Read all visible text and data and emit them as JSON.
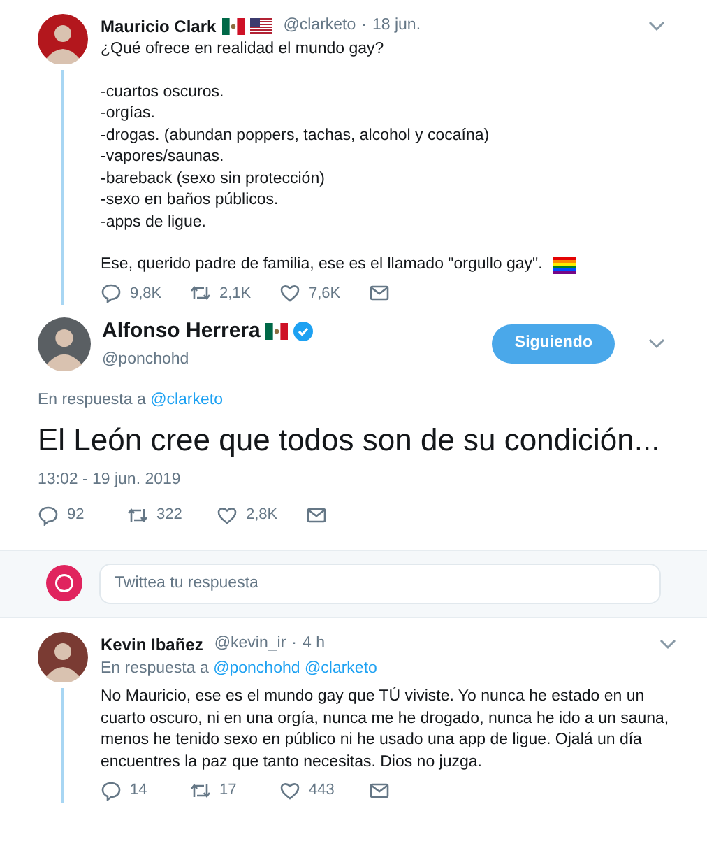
{
  "tweets": [
    {
      "kind": "thread",
      "name": "Mauricio Clark",
      "badges": [
        {
          "kind": "mexico"
        },
        {
          "kind": "usa"
        }
      ],
      "handle": "@clarketo",
      "separator": "·",
      "time": "18 jun.",
      "paragraphs": [
        "¿Qué ofrece en realidad el mundo gay?",
        "-cuartos oscuros.\n-orgías.\n-drogas. (abundan poppers, tachas, alcohol y cocaína)\n-vapores/saunas.\n-bareback (sexo sin protección)\n-sexo en baños públicos.\n-apps de ligue.",
        "Ese, querido padre de familia, ese es el llamado \"orgullo gay\"."
      ],
      "end_icon": {
        "kind": "rainbow"
      },
      "stats": {
        "replies": "9,8K",
        "retweets": "2,1K",
        "likes": "7,6K"
      }
    },
    {
      "kind": "focus",
      "name": "Alfonso Herrera",
      "badges": [
        {
          "kind": "mexico"
        },
        {
          "kind": "verified"
        }
      ],
      "handle": "@ponchohd",
      "follow_button": "Siguiendo",
      "reply_label": "En respuesta a",
      "reply_to": [
        "@clarketo"
      ],
      "text": "El León cree que todos son de su condición...",
      "timestamp": "13:02 - 19 jun. 2019",
      "stats": {
        "replies": "92",
        "retweets": "322",
        "likes": "2,8K"
      }
    },
    {
      "kind": "composer",
      "placeholder": "Twittea tu respuesta"
    },
    {
      "kind": "reply",
      "name": "Kevin Ibañez",
      "handle": "@kevin_ir",
      "separator": "·",
      "time": "4 h",
      "reply_label": "En respuesta a",
      "reply_to": [
        "@ponchohd",
        "@clarketo"
      ],
      "paragraphs": [
        "No Mauricio, ese es el mundo gay que TÚ viviste. Yo nunca he estado en un cuarto oscuro, ni en una orgía, nunca me he drogado, nunca he ido a un sauna, menos he tenido sexo en público ni he usado una app de ligue. Ojalá un día encuentres la paz que tanto necesitas. Dios no juzga."
      ],
      "stats": {
        "replies": "14",
        "retweets": "17",
        "likes": "443"
      }
    }
  ]
}
